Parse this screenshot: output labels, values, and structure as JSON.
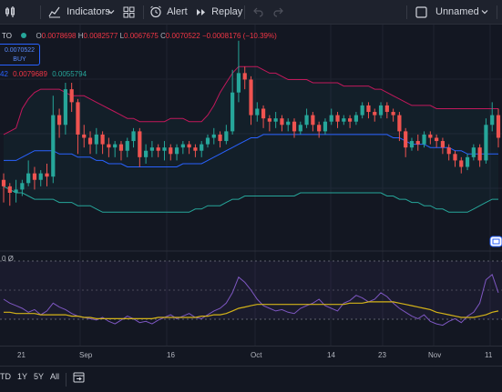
{
  "toolbar": {
    "indicators_label": "Indicators",
    "alert_label": "Alert",
    "replay_label": "Replay",
    "layout_label": "Unnamed"
  },
  "legend": {
    "symbol": "TO",
    "open_label": "O",
    "open_value": "0.0078698",
    "high_label": "H",
    "high_value": "0.0082577",
    "low_label": "L",
    "low_value": "0.0067675",
    "close_label": "C",
    "close_value": "0.0070522",
    "change": "−0.0008176 (−10.39%)",
    "bb_mid": "42",
    "bb_upper": "0.0079689",
    "bb_lower": "0.0055794",
    "buy_price": "0.0070522",
    "buy_label": "BUY",
    "rsi_label": "0 Ø"
  },
  "colors": {
    "up": "#26a69a",
    "down": "#ef5350",
    "bb_upper": "#c2185b",
    "bb_basis": "#2962ff",
    "bb_lower": "#26a69a",
    "rsi": "#7e57c2",
    "rsi_ma": "#d4b318"
  },
  "xaxis": {
    "labels": [
      "21",
      "Sep",
      "16",
      "Oct",
      "14",
      "23",
      "Nov",
      "11"
    ]
  },
  "bottombar": {
    "ranges": [
      "TD",
      "1Y",
      "5Y",
      "All"
    ]
  },
  "chart_data": {
    "type": "candlestick",
    "candles": [
      [
        62,
        60,
        55,
        64
      ],
      [
        60,
        58,
        54,
        61
      ],
      [
        58,
        59,
        55,
        62
      ],
      [
        59,
        61,
        57,
        62
      ],
      [
        61,
        64,
        60,
        68
      ],
      [
        64,
        62,
        59,
        66
      ],
      [
        62,
        64,
        60,
        65
      ],
      [
        64,
        63,
        60,
        67
      ],
      [
        63,
        82,
        61,
        88
      ],
      [
        82,
        79,
        75,
        84
      ],
      [
        79,
        90,
        76,
        92
      ],
      [
        90,
        86,
        83,
        92
      ],
      [
        86,
        76,
        70,
        87
      ],
      [
        76,
        75,
        72,
        79
      ],
      [
        75,
        73,
        70,
        77
      ],
      [
        73,
        76,
        70,
        78
      ],
      [
        76,
        73,
        70,
        77
      ],
      [
        73,
        72,
        69,
        75
      ],
      [
        72,
        73,
        69,
        74
      ],
      [
        73,
        71,
        68,
        74
      ],
      [
        71,
        74,
        69,
        75
      ],
      [
        74,
        77,
        72,
        78
      ],
      [
        77,
        69,
        66,
        78
      ],
      [
        69,
        71,
        67,
        73
      ],
      [
        71,
        72,
        69,
        74
      ],
      [
        72,
        71,
        69,
        73
      ],
      [
        71,
        72,
        68,
        74
      ],
      [
        72,
        70,
        68,
        73
      ],
      [
        70,
        72,
        68,
        73
      ],
      [
        72,
        73,
        70,
        74
      ],
      [
        73,
        72,
        70,
        74
      ],
      [
        72,
        71,
        69,
        73
      ],
      [
        71,
        73,
        69,
        74
      ],
      [
        73,
        75,
        72,
        76
      ],
      [
        75,
        76,
        73,
        78
      ],
      [
        76,
        74,
        72,
        77
      ],
      [
        74,
        77,
        73,
        79
      ],
      [
        77,
        89,
        76,
        96
      ],
      [
        89,
        95,
        86,
        105
      ],
      [
        95,
        93,
        90,
        97
      ],
      [
        93,
        82,
        79,
        94
      ],
      [
        82,
        84,
        80,
        86
      ],
      [
        84,
        81,
        78,
        85
      ],
      [
        81,
        80,
        77,
        82
      ],
      [
        80,
        81,
        78,
        83
      ],
      [
        81,
        79,
        77,
        82
      ],
      [
        79,
        80,
        77,
        81
      ],
      [
        80,
        77,
        75,
        81
      ],
      [
        77,
        79,
        76,
        80
      ],
      [
        79,
        82,
        78,
        84
      ],
      [
        82,
        79,
        77,
        83
      ],
      [
        79,
        77,
        75,
        80
      ],
      [
        77,
        80,
        76,
        81
      ],
      [
        80,
        82,
        79,
        84
      ],
      [
        82,
        80,
        78,
        83
      ],
      [
        80,
        81,
        79,
        82
      ],
      [
        81,
        80,
        78,
        82
      ],
      [
        80,
        82,
        79,
        83
      ],
      [
        82,
        85,
        81,
        86
      ],
      [
        85,
        83,
        81,
        86
      ],
      [
        83,
        82,
        80,
        84
      ],
      [
        82,
        85,
        81,
        86
      ],
      [
        85,
        83,
        81,
        86
      ],
      [
        83,
        82,
        80,
        84
      ],
      [
        82,
        77,
        74,
        83
      ],
      [
        77,
        72,
        69,
        78
      ],
      [
        72,
        74,
        71,
        75
      ],
      [
        74,
        73,
        71,
        76
      ],
      [
        73,
        76,
        72,
        77
      ],
      [
        76,
        75,
        73,
        77
      ],
      [
        75,
        74,
        72,
        76
      ],
      [
        74,
        72,
        70,
        75
      ],
      [
        72,
        70,
        68,
        73
      ],
      [
        70,
        68,
        66,
        71
      ],
      [
        68,
        66,
        64,
        69
      ],
      [
        66,
        69,
        65,
        70
      ],
      [
        69,
        72,
        68,
        73
      ],
      [
        72,
        68,
        66,
        73
      ],
      [
        68,
        79,
        67,
        81
      ],
      [
        79,
        82,
        77,
        86
      ],
      [
        82,
        75,
        72,
        84
      ]
    ],
    "bb_upper": [
      76,
      77,
      78,
      84,
      87,
      89,
      90,
      90,
      90,
      90,
      89,
      88,
      88,
      88,
      87,
      86,
      85,
      84,
      83,
      82,
      81,
      81,
      80,
      80,
      80,
      80,
      80,
      81,
      81,
      81,
      80,
      80,
      80,
      82,
      85,
      89,
      92,
      95,
      97,
      97,
      97,
      97,
      96,
      95,
      95,
      94,
      93,
      93,
      93,
      93,
      92,
      92,
      92,
      92,
      92,
      91,
      91,
      91,
      91,
      91,
      90,
      90,
      89,
      88,
      87,
      86,
      85,
      85,
      85,
      85,
      84,
      84,
      84,
      84,
      84,
      84,
      84,
      84,
      84,
      84,
      84
    ],
    "bb_basis": [
      68,
      68,
      68,
      69,
      70,
      71,
      71,
      71,
      71,
      70,
      70,
      70,
      69,
      69,
      69,
      68,
      68,
      67,
      67,
      67,
      66,
      66,
      66,
      66,
      66,
      66,
      66,
      66,
      66,
      67,
      67,
      67,
      67,
      68,
      69,
      70,
      71,
      72,
      73,
      74,
      75,
      75,
      76,
      76,
      76,
      76,
      76,
      76,
      76,
      76,
      76,
      76,
      76,
      76,
      76,
      76,
      76,
      76,
      76,
      76,
      76,
      76,
      76,
      75,
      75,
      74,
      73,
      73,
      73,
      72,
      72,
      72,
      72,
      71,
      71,
      70,
      70,
      70,
      70,
      70,
      70
    ],
    "bb_lower": [
      60,
      59,
      58,
      58,
      57,
      56,
      56,
      56,
      56,
      55,
      55,
      55,
      54,
      54,
      54,
      53,
      52,
      52,
      52,
      52,
      52,
      52,
      52,
      52,
      52,
      52,
      52,
      52,
      52,
      52,
      52,
      53,
      53,
      54,
      54,
      54,
      55,
      56,
      56,
      57,
      57,
      57,
      57,
      57,
      57,
      57,
      57,
      57,
      58,
      58,
      58,
      58,
      58,
      58,
      58,
      58,
      58,
      58,
      58,
      58,
      58,
      58,
      57,
      57,
      56,
      56,
      55,
      55,
      54,
      54,
      53,
      53,
      52,
      52,
      52,
      52,
      53,
      54,
      55,
      56,
      56
    ],
    "rsi": [
      55,
      52,
      50,
      48,
      45,
      47,
      43,
      46,
      52,
      49,
      47,
      44,
      42,
      41,
      40,
      39,
      41,
      38,
      36,
      39,
      42,
      40,
      37,
      38,
      36,
      39,
      41,
      43,
      40,
      42,
      44,
      41,
      40,
      43,
      46,
      48,
      52,
      60,
      72,
      68,
      62,
      55,
      50,
      48,
      46,
      47,
      45,
      44,
      48,
      50,
      52,
      55,
      50,
      48,
      46,
      52,
      54,
      58,
      56,
      53,
      55,
      60,
      57,
      52,
      48,
      45,
      42,
      40,
      43,
      38,
      36,
      35,
      38,
      40,
      37,
      42,
      45,
      52,
      70,
      74,
      60
    ],
    "rsi_ma": [
      45,
      45,
      44,
      44,
      44,
      44,
      43,
      43,
      43,
      43,
      43,
      42,
      42,
      41,
      41,
      40,
      40,
      40,
      40,
      40,
      40,
      40,
      40,
      40,
      40,
      41,
      41,
      41,
      41,
      41,
      41,
      41,
      42,
      42,
      43,
      43,
      44,
      46,
      48,
      49,
      50,
      51,
      51,
      51,
      51,
      51,
      51,
      51,
      51,
      51,
      51,
      51,
      51,
      51,
      51,
      51,
      52,
      52,
      52,
      53,
      53,
      53,
      53,
      53,
      52,
      51,
      50,
      49,
      48,
      47,
      45,
      44,
      43,
      42,
      41,
      41,
      41,
      42,
      43,
      45,
      46
    ],
    "ylim": [
      40,
      110
    ],
    "rsi_ylim": [
      20,
      90
    ]
  }
}
